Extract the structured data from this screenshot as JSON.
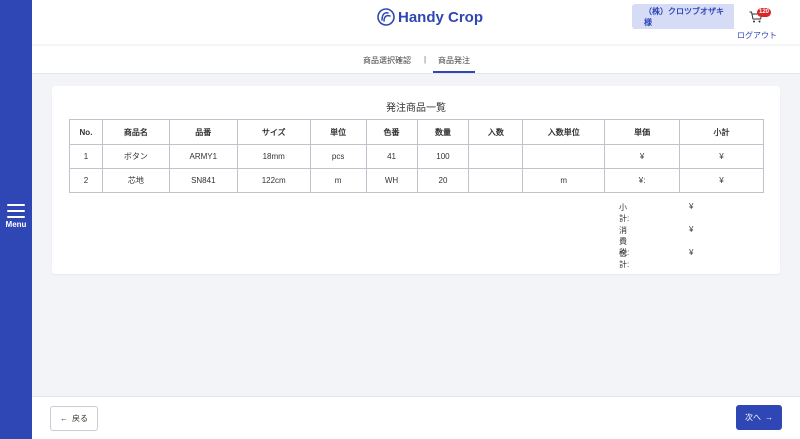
{
  "app": {
    "logo_text": "Handy Crop",
    "user_name": "（株）クロツブオザキ 様",
    "cart_count": "120",
    "logout_label": "ログアウト"
  },
  "sidebar": {
    "menu_label": "Menu"
  },
  "tabs": [
    {
      "label": "商品選択確認",
      "active": false
    },
    {
      "label": "|"
    },
    {
      "label": "商品発注",
      "active": true
    }
  ],
  "main": {
    "title": "発注商品一覧",
    "columns": [
      "No.",
      "商品名",
      "品番",
      "サイズ",
      "単位",
      "色番",
      "数量",
      "入数",
      "入数単位",
      "単価",
      "小計"
    ],
    "rows": [
      [
        "1",
        "ボタン",
        "ARMY1",
        "18mm",
        "pcs",
        "41",
        "100",
        "",
        "",
        "¥",
        "¥"
      ],
      [
        "2",
        "芯地",
        "SN841",
        "122cm",
        "m",
        "WH",
        "20",
        "",
        "m",
        "¥:",
        "¥"
      ]
    ],
    "totals": [
      {
        "label": "小計:",
        "value": "¥"
      },
      {
        "label": "消費税:",
        "value": "¥"
      },
      {
        "label": "合計:",
        "value": "¥"
      }
    ]
  },
  "footer": {
    "back_arrow": "←",
    "back_label": "戻る",
    "next_label": "次へ",
    "next_arrow": "→"
  },
  "colors": {
    "brand": "#2f47b5",
    "badge": "#d9262b",
    "user_box": "#d6dcf5",
    "background": "#f3f4f8"
  },
  "icons": [
    "menu-icon",
    "logo-icon",
    "cart-icon",
    "arrow-left-icon",
    "arrow-right-icon"
  ]
}
